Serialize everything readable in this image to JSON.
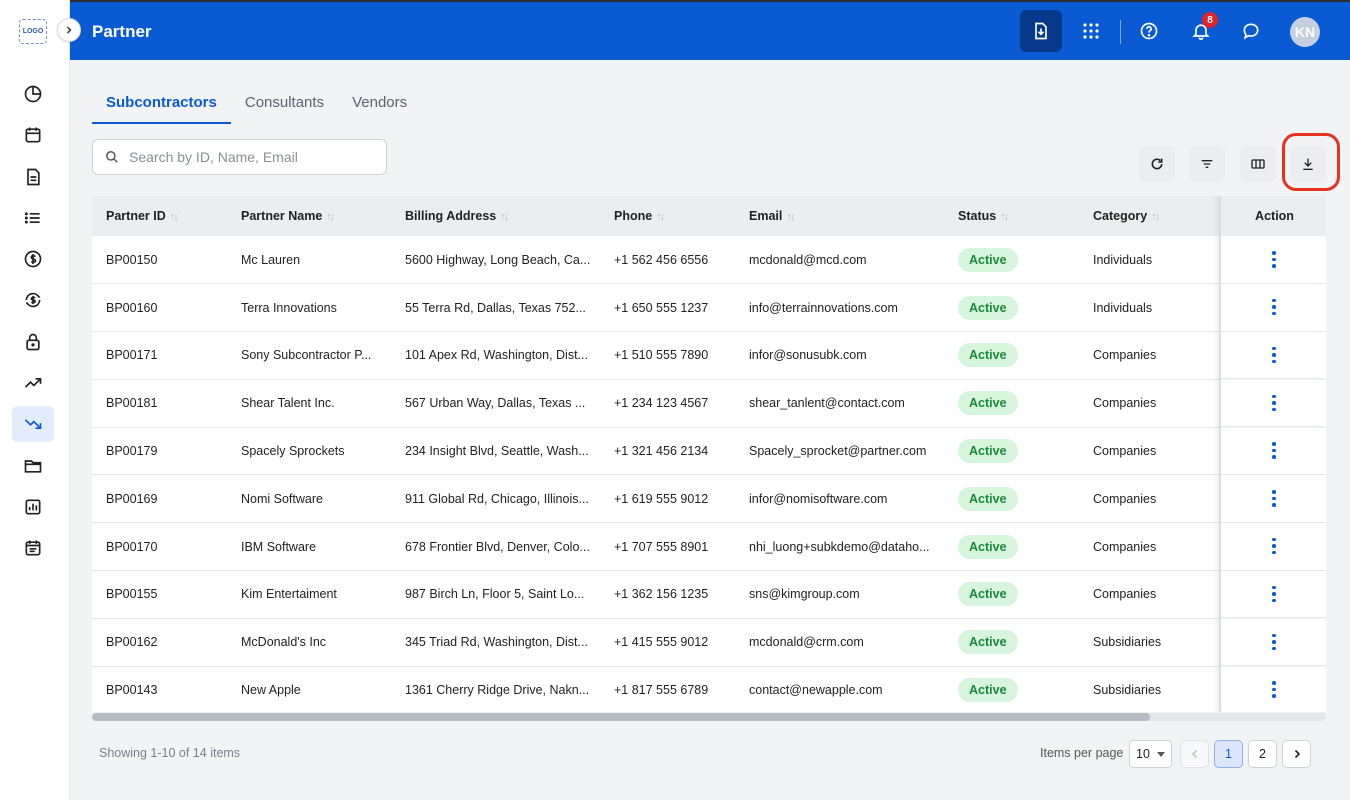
{
  "app": {
    "logo_text": "LOGO",
    "title": "Partner",
    "notification_count": "8",
    "user_initials": "KN"
  },
  "sidebar": {
    "items": [
      {
        "icon": "pie-chart-icon"
      },
      {
        "icon": "calendar-icon"
      },
      {
        "icon": "document-icon"
      },
      {
        "icon": "list-icon"
      },
      {
        "icon": "dollar-circle-icon"
      },
      {
        "icon": "currency-exchange-icon"
      },
      {
        "icon": "lock-icon"
      },
      {
        "icon": "trending-up-icon"
      },
      {
        "icon": "trending-down-icon",
        "active": true
      },
      {
        "icon": "folder-icon"
      },
      {
        "icon": "bar-chart-icon"
      },
      {
        "icon": "calendar-list-icon"
      }
    ]
  },
  "tabs": [
    {
      "label": "Subcontractors",
      "active": true
    },
    {
      "label": "Consultants"
    },
    {
      "label": "Vendors"
    }
  ],
  "search": {
    "placeholder": "Search by ID, Name, Email"
  },
  "table": {
    "columns": [
      "Partner ID",
      "Partner Name",
      "Billing Address",
      "Phone",
      "Email",
      "Status",
      "Category"
    ],
    "action_header": "Action",
    "rows": [
      {
        "id": "BP00150",
        "name": "Mc Lauren",
        "address": "5600 Highway, Long Beach, Ca...",
        "phone": "+1 562 456 6556",
        "email": "mcdonald@mcd.com",
        "status": "Active",
        "category": "Individuals"
      },
      {
        "id": "BP00160",
        "name": "Terra Innovations",
        "address": "55 Terra Rd, Dallas, Texas 752...",
        "phone": "+1 650 555 1237",
        "email": "info@terrainnovations.com",
        "status": "Active",
        "category": "Individuals"
      },
      {
        "id": "BP00171",
        "name": "Sony Subcontractor P...",
        "address": "101 Apex Rd, Washington, Dist...",
        "phone": "+1 510 555 7890",
        "email": "infor@sonusubk.com",
        "status": "Active",
        "category": "Companies"
      },
      {
        "id": "BP00181",
        "name": "Shear Talent Inc.",
        "address": "567 Urban Way, Dallas, Texas ...",
        "phone": "+1 234 123 4567",
        "email": "shear_tanlent@contact.com",
        "status": "Active",
        "category": "Companies"
      },
      {
        "id": "BP00179",
        "name": "Spacely Sprockets",
        "address": "234 Insight Blvd, Seattle, Wash...",
        "phone": "+1 321 456 2134",
        "email": "Spacely_sprocket@partner.com",
        "status": "Active",
        "category": "Companies"
      },
      {
        "id": "BP00169",
        "name": "Nomi Software",
        "address": "911 Global Rd, Chicago, Illinois...",
        "phone": "+1 619 555 9012",
        "email": "infor@nomisoftware.com",
        "status": "Active",
        "category": "Companies"
      },
      {
        "id": "BP00170",
        "name": "IBM Software",
        "address": "678 Frontier Blvd, Denver, Colo...",
        "phone": "+1 707 555 8901",
        "email": "nhi_luong+subkdemo@dataho...",
        "status": "Active",
        "category": "Companies"
      },
      {
        "id": "BP00155",
        "name": "Kim Entertaiment",
        "address": "987 Birch Ln, Floor 5, Saint Lo...",
        "phone": "+1 362 156 1235",
        "email": "sns@kimgroup.com",
        "status": "Active",
        "category": "Companies"
      },
      {
        "id": "BP00162",
        "name": "McDonald's Inc",
        "address": "345 Triad Rd, Washington, Dist...",
        "phone": "+1 415 555 9012",
        "email": "mcdonald@crm.com",
        "status": "Active",
        "category": "Subsidiaries"
      },
      {
        "id": "BP00143",
        "name": "New Apple",
        "address": "1361 Cherry Ridge Drive, Nakn...",
        "phone": "+1 817 555 6789",
        "email": "contact@newapple.com",
        "status": "Active",
        "category": "Subsidiaries"
      }
    ]
  },
  "footer": {
    "showing": "Showing 1-10 of 14 items",
    "items_per_page_label": "Items per page",
    "items_per_page": "10",
    "pages": [
      "1",
      "2"
    ],
    "current_page": "1"
  },
  "colors": {
    "header": "#0a5ad4",
    "accent": "#0a5ad4",
    "status_active_bg": "#d6f5dc",
    "status_active_text": "#1b8a3a",
    "highlight": "#e8321f"
  }
}
